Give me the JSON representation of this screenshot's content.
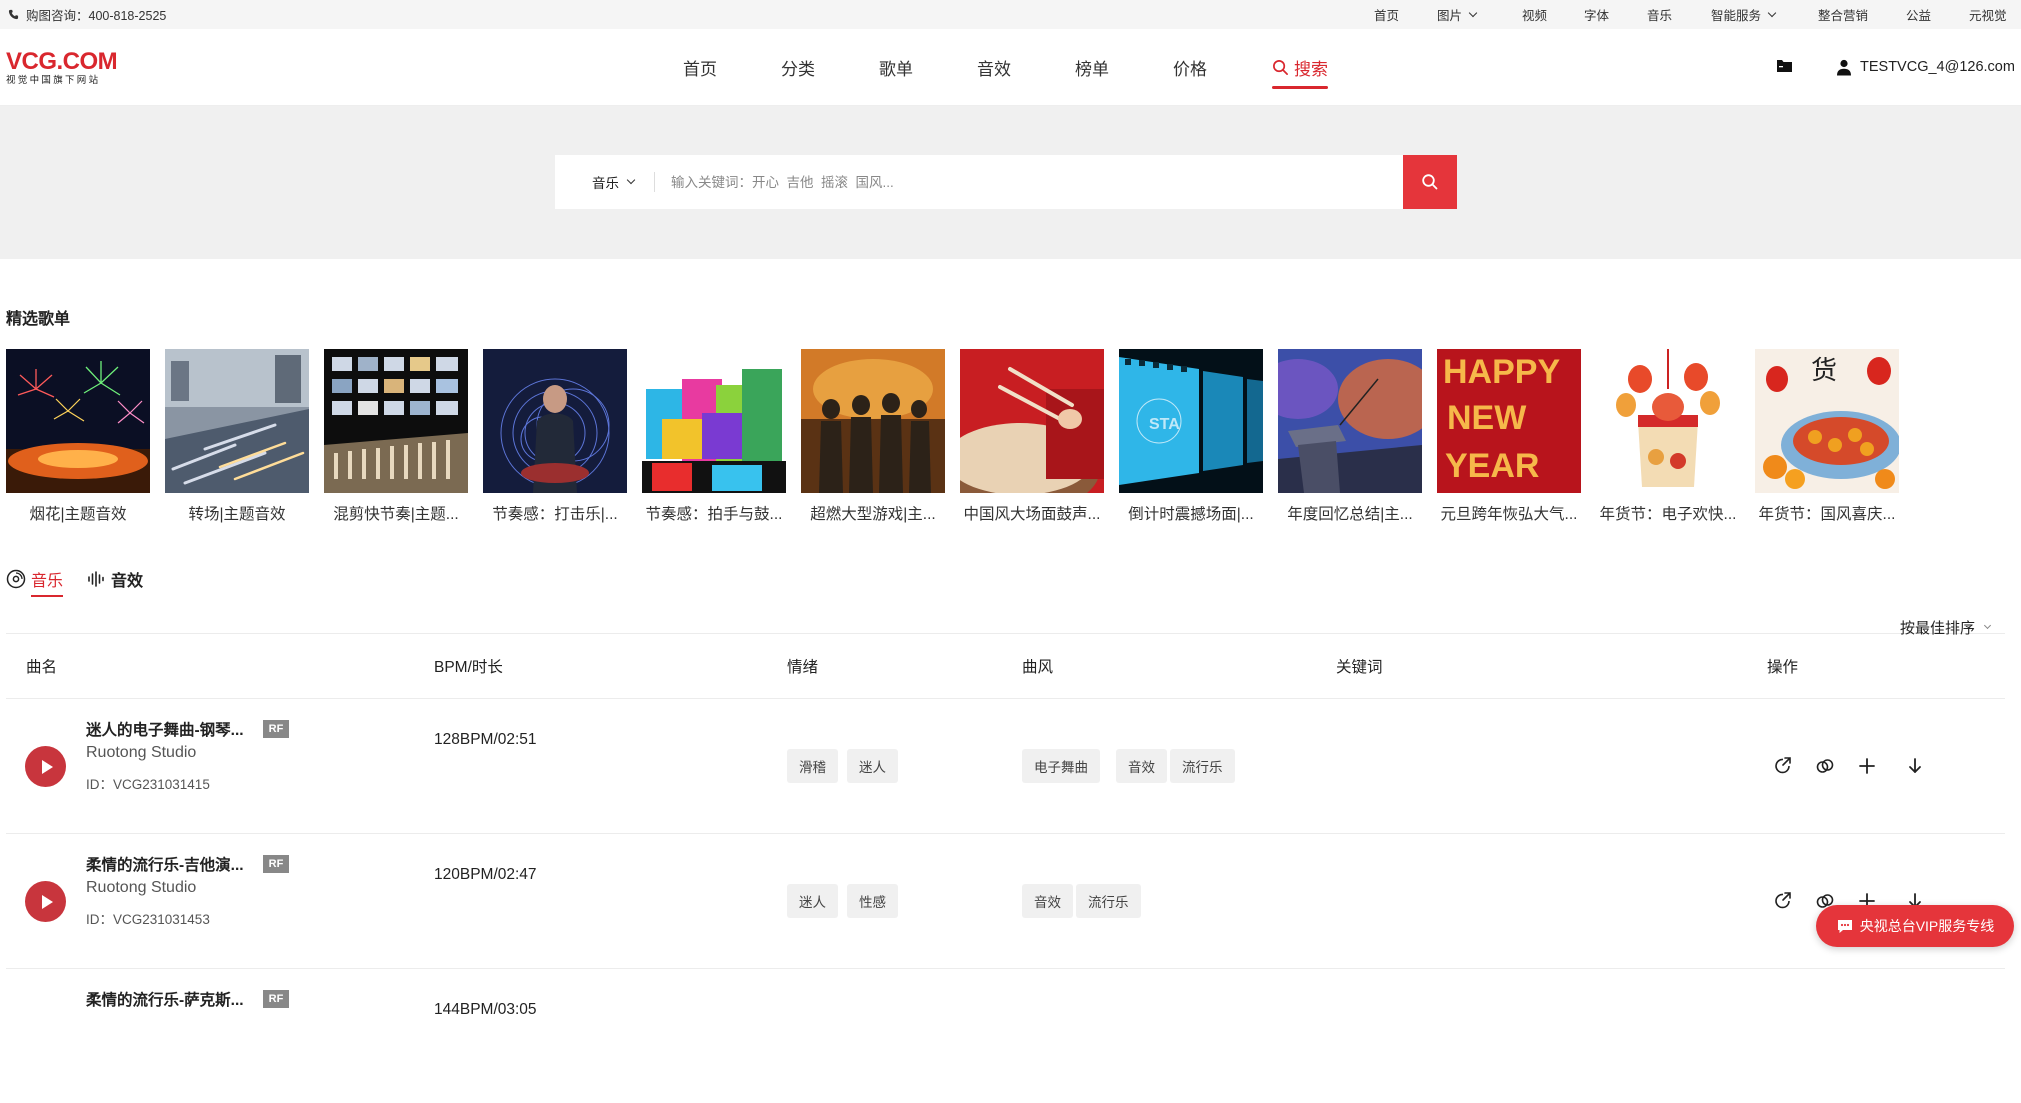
{
  "topbar": {
    "hotline": "购图咨询：400-818-2525",
    "links": [
      "首页",
      "图片",
      "视频",
      "字体",
      "音乐",
      "智能服务",
      "整合营销",
      "公益",
      "元视觉"
    ]
  },
  "header": {
    "logo_main": "VCG.COM",
    "logo_sub": "视觉中国旗下网站",
    "nav": [
      "首页",
      "分类",
      "歌单",
      "音效",
      "榜单",
      "价格",
      "搜索"
    ],
    "user": "TESTVCG_4@126.com",
    "accent_color": "#d9272e"
  },
  "search": {
    "type": "音乐",
    "value": "",
    "placeholder": "输入关键词：开心  吉他  摇滚  国风..."
  },
  "playlists": {
    "title": "精选歌单",
    "items": [
      {
        "name": "烟花|主题音效"
      },
      {
        "name": "转场|主题音效"
      },
      {
        "name": "混剪快节奏|主题..."
      },
      {
        "name": "节奏感：打击乐|..."
      },
      {
        "name": "节奏感：拍手与鼓..."
      },
      {
        "name": "超燃大型游戏|主..."
      },
      {
        "name": "中国风大场面鼓声..."
      },
      {
        "name": "倒计时震撼场面|..."
      },
      {
        "name": "年度回忆总结|主..."
      },
      {
        "name": "元旦跨年恢弘大气..."
      },
      {
        "name": "年货节：电子欢快..."
      },
      {
        "name": "年货节：国风喜庆..."
      }
    ]
  },
  "tabs": {
    "music": "音乐",
    "sfx": "音效",
    "sort": "按最佳排序"
  },
  "table": {
    "headers": {
      "name": "曲名",
      "bpm": "BPM/时长",
      "mood": "情绪",
      "genre": "曲风",
      "keywords": "关键词",
      "ops": "操作"
    },
    "rows": [
      {
        "title": "迷人的电子舞曲-钢琴...",
        "license": "RF",
        "artist": "Ruotong Studio",
        "id": "ID：VCG231031415",
        "bpm": "128BPM/02:51",
        "moods": [
          "滑稽",
          "迷人"
        ],
        "genres": [
          "电子舞曲",
          "音效",
          "流行乐"
        ]
      },
      {
        "title": "柔情的流行乐-吉他演...",
        "license": "RF",
        "artist": "Ruotong Studio",
        "id": "ID：VCG231031453",
        "bpm": "120BPM/02:47",
        "moods": [
          "迷人",
          "性感"
        ],
        "genres": [
          "音效",
          "流行乐"
        ]
      },
      {
        "title": "柔情的流行乐-萨克斯...",
        "license": "RF",
        "artist": "",
        "id": "",
        "bpm": "144BPM/03:05",
        "moods": [],
        "genres": []
      }
    ]
  },
  "vip": {
    "label": "央视总台VIP服务专线"
  }
}
